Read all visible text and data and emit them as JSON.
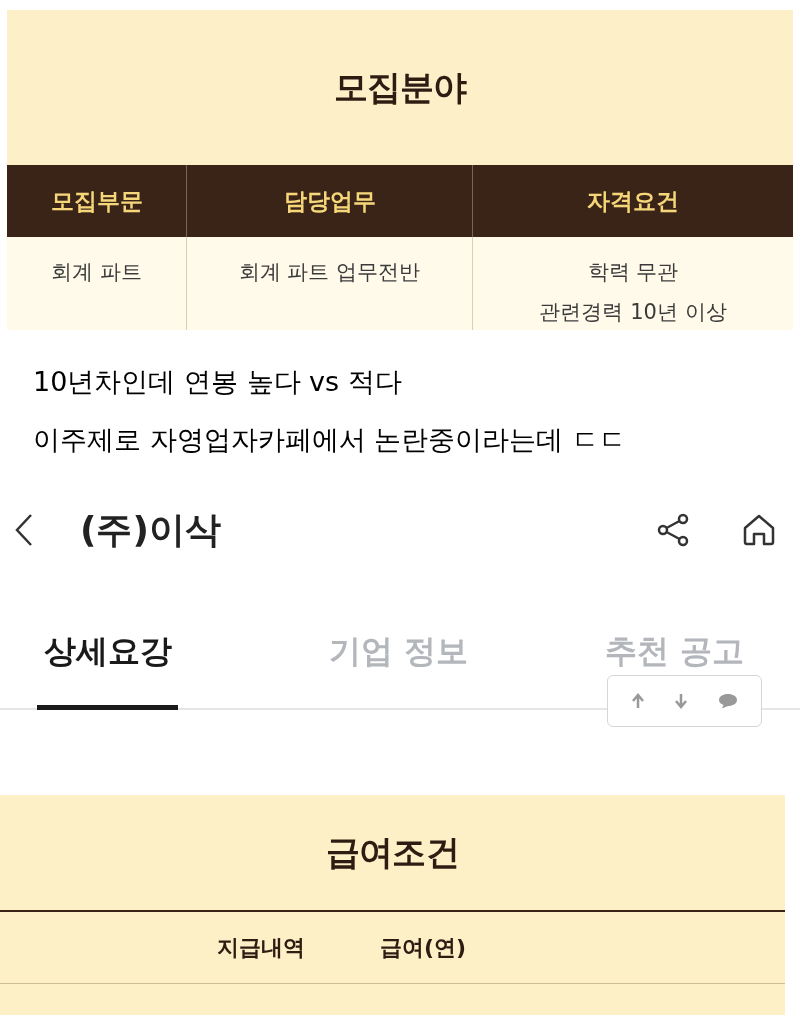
{
  "recruit_panel": {
    "title": "모집분야",
    "columns": [
      "모집부문",
      "담당업무",
      "자격요건"
    ],
    "rows": [
      [
        {
          "lines": [
            "회계 파트"
          ]
        },
        {
          "lines": [
            "회계 파트 업무전반"
          ]
        },
        {
          "lines": [
            "학력 무관",
            "관련경력 10년 이상"
          ]
        }
      ]
    ]
  },
  "captions": [
    "10년차인데 연봉 높다 vs 적다",
    "이주제로 자영업자카페에서 논란중이라는데 ㄷㄷ"
  ],
  "app_header": {
    "title": "(주)이삭"
  },
  "tabs": [
    {
      "label": "상세요강",
      "selected": true
    },
    {
      "label": "기업 정보",
      "selected": false
    },
    {
      "label": "추천 공고",
      "selected": false
    }
  ],
  "salary_panel": {
    "title": "급여조건",
    "columns": [
      "지급내역",
      "급여(연)"
    ]
  }
}
